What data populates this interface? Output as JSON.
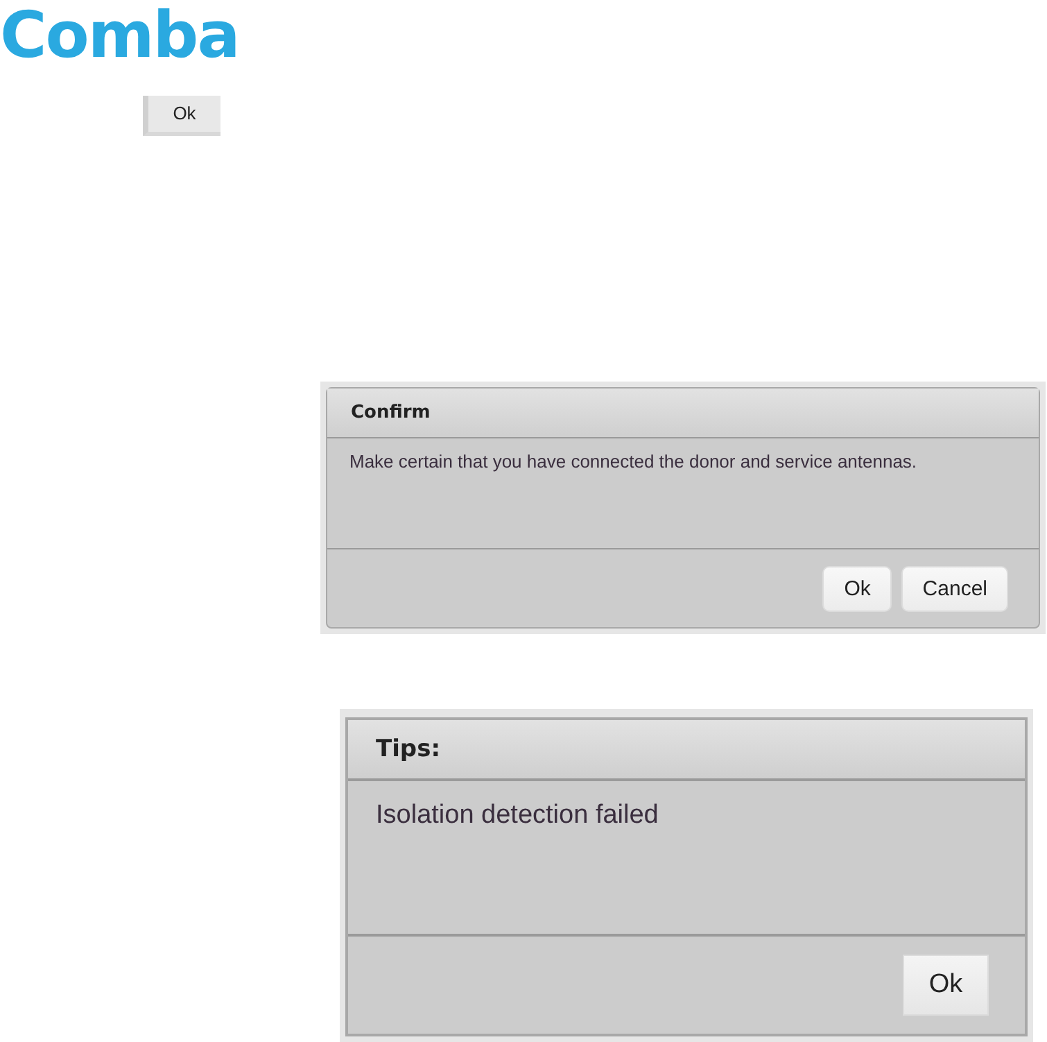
{
  "logo": {
    "text": "Comba"
  },
  "top_button": {
    "label": "Ok"
  },
  "dialogs": [
    {
      "kind": "small",
      "title": "Confirm",
      "message": "Make certain that you have connected the donor and service antennas.",
      "buttons": [
        "Ok",
        "Cancel"
      ]
    },
    {
      "kind": "large",
      "title": "Tips:",
      "message": "Isolation detection failed",
      "buttons": [
        "Ok"
      ]
    }
  ]
}
